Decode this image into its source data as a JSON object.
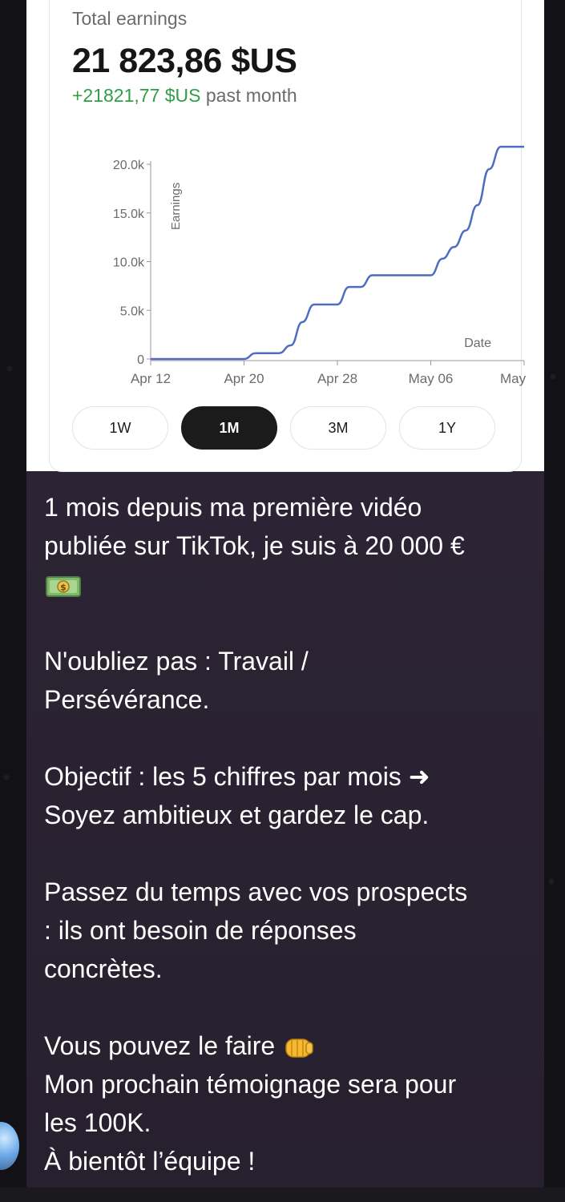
{
  "earnings_card": {
    "total_label": "Total earnings",
    "total_value": "21 823,86 $US",
    "delta_value": "+21821,77 $US",
    "delta_period": "past month"
  },
  "chart_data": {
    "type": "line",
    "ylabel": "Earnings",
    "xlabel": "Date",
    "y_ticks": [
      "0",
      "5.0k",
      "10.0k",
      "15.0k",
      "20.0k"
    ],
    "y_tick_values": [
      0,
      5000,
      10000,
      15000,
      20000
    ],
    "x_ticks": [
      "Apr 12",
      "Apr 20",
      "Apr 28",
      "May 06",
      "May"
    ],
    "x_tick_values": [
      "2024-04-12",
      "2024-04-20",
      "2024-04-28",
      "2024-05-06",
      "2024-05-14"
    ],
    "ylim": [
      0,
      20000
    ],
    "grid": false,
    "line_color": "#4d6dbf",
    "series": [
      {
        "x": [
          "2024-04-12",
          "2024-04-15",
          "2024-04-18",
          "2024-04-20",
          "2024-04-21",
          "2024-04-22",
          "2024-04-23",
          "2024-04-24",
          "2024-04-25",
          "2024-04-26",
          "2024-04-27",
          "2024-04-28",
          "2024-04-29",
          "2024-04-30",
          "2024-05-01",
          "2024-05-02",
          "2024-05-03",
          "2024-05-04",
          "2024-05-05",
          "2024-05-06",
          "2024-05-07",
          "2024-05-08",
          "2024-05-09",
          "2024-05-10",
          "2024-05-11",
          "2024-05-12",
          "2024-05-13",
          "2024-05-14"
        ],
        "y": [
          0,
          0,
          0,
          0,
          600,
          600,
          600,
          1400,
          3800,
          5600,
          5600,
          5600,
          7400,
          7400,
          8600,
          8600,
          8600,
          8600,
          8600,
          8600,
          10300,
          11500,
          13200,
          15800,
          19500,
          21800,
          21800,
          21800
        ]
      }
    ]
  },
  "range_buttons": [
    {
      "label": "1W",
      "active": false
    },
    {
      "label": "1M",
      "active": true
    },
    {
      "label": "3M",
      "active": false
    },
    {
      "label": "1Y",
      "active": false
    }
  ],
  "message": {
    "p1_line1": "1 mois depuis ma première vidéo",
    "p1_line2": "publiée sur TikTok, je suis à 20 000 €",
    "p1_emoji": "💵",
    "p2_line1": "N'oubliez pas : Travail /",
    "p2_line2": "Persévérance.",
    "p3_line1": "Objectif  : les 5 chiffres par mois ➜",
    "p3_line2": "Soyez ambitieux et gardez le cap.",
    "p4_line1": "Passez du temps avec vos prospects",
    "p4_line2": ": ils ont besoin de réponses",
    "p4_line3": "concrètes.",
    "p5_line1": "Vous pouvez le faire",
    "p5_emoji": "👊",
    "p5_line2": "Mon prochain témoignage sera pour",
    "p5_line3": "les 100K.",
    "p5_line4": "À bientôt l’équipe !"
  },
  "icons": {
    "money": "money-bill-icon",
    "fist": "fist-bump-icon",
    "avatar": "avatar"
  }
}
